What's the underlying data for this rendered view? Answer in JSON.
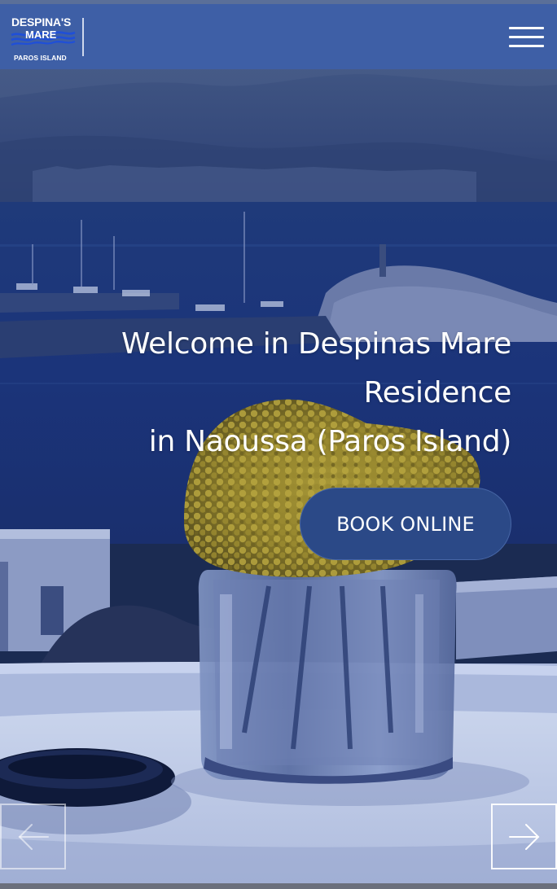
{
  "header": {
    "logo": {
      "line1": "DESPINA'S",
      "line2": "MARE",
      "subtitle": "PAROS ISLAND"
    },
    "menu_icon": "hamburger-icon",
    "colors": {
      "bar": "#3e5fa6",
      "accent": "#2b4987"
    }
  },
  "hero": {
    "welcome_lines": [
      "Welcome in Despinas Mare",
      "Residence",
      "in Naoussa (Paros Island)"
    ],
    "book_button_label": "BOOK ONLINE"
  },
  "slider": {
    "prev_icon": "arrow-left-icon",
    "next_icon": "arrow-right-icon"
  }
}
